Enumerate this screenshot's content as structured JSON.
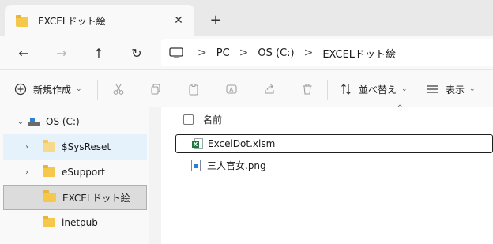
{
  "tab": {
    "title": "EXCELドット絵",
    "close_glyph": "✕",
    "new_glyph": "+"
  },
  "nav": {
    "back_glyph": "←",
    "forward_glyph": "→",
    "up_glyph": "↑",
    "refresh_glyph": "↻",
    "breadcrumbs": [
      "PC",
      "OS (C:)",
      "EXCELドット絵"
    ],
    "sep_glyph": ">"
  },
  "toolbar": {
    "new_label": "新規作成",
    "sort_label": "並べ替え",
    "view_label": "表示"
  },
  "sidebar": {
    "items": [
      {
        "label": "OS (C:)"
      },
      {
        "label": "$SysReset"
      },
      {
        "label": "eSupport"
      },
      {
        "label": "EXCELドット絵"
      },
      {
        "label": "inetpub"
      }
    ]
  },
  "main": {
    "column_name": "名前",
    "files": [
      {
        "name": "ExcelDot.xlsm",
        "icon": "excel-file-icon"
      },
      {
        "name": "三人官女.png",
        "icon": "image-file-icon"
      }
    ]
  },
  "colors": {
    "accent": "#005fb8",
    "folder": "#f5c84c",
    "selected_bg": "#dcdcdc",
    "hover_bg": "#e5f1fb"
  }
}
